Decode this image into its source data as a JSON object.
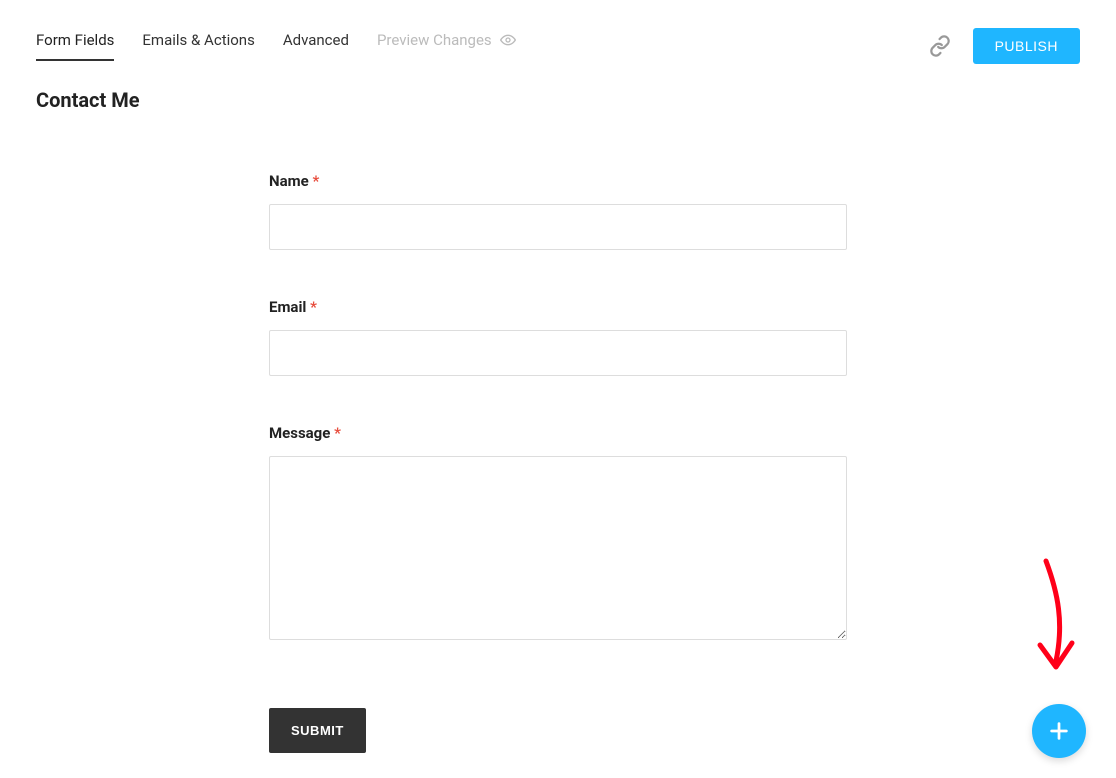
{
  "tabs": {
    "form_fields": "Form Fields",
    "emails_actions": "Emails & Actions",
    "advanced": "Advanced",
    "preview_changes": "Preview Changes"
  },
  "actions": {
    "publish": "PUBLISH"
  },
  "page": {
    "title": "Contact Me"
  },
  "form": {
    "name": {
      "label": "Name",
      "required": "*",
      "value": ""
    },
    "email": {
      "label": "Email",
      "required": "*",
      "value": ""
    },
    "message": {
      "label": "Message",
      "required": "*",
      "value": ""
    },
    "submit": "SUBMIT"
  },
  "colors": {
    "accent": "#1fb6ff",
    "required": "#e74c3c",
    "annotation": "#ff0019"
  }
}
